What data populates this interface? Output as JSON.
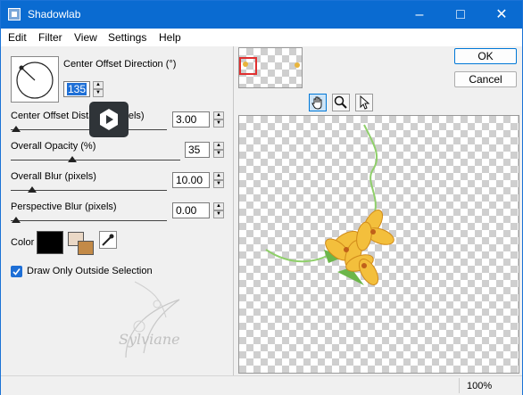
{
  "window": {
    "title": "Shadowlab"
  },
  "menu": [
    "Edit",
    "Filter",
    "View",
    "Settings",
    "Help"
  ],
  "controls": {
    "direction": {
      "label": "Center Offset Direction (°)",
      "value": "135"
    },
    "offset": {
      "label": "Center Offset Distance (pixels)",
      "value": "3.00"
    },
    "opacity": {
      "label": "Overall Opacity (%)",
      "value": "35"
    },
    "blur": {
      "label": "Overall Blur (pixels)",
      "value": "10.00"
    },
    "perspective": {
      "label": "Perspective Blur (pixels)",
      "value": "0.00"
    },
    "color": {
      "label": "Color",
      "swatch": "#000000",
      "secondary_top": "#ead8c6",
      "secondary_bottom": "#c38a47"
    },
    "outside_selection": {
      "label": "Draw Only Outside Selection",
      "checked": true
    }
  },
  "buttons": {
    "ok": "OK",
    "cancel": "Cancel"
  },
  "tools": [
    "hand-icon",
    "zoom-icon",
    "pointer-icon"
  ],
  "watermark": {
    "text": "Sylviane"
  },
  "status": {
    "zoom": "100%"
  },
  "colors": {
    "accent": "#0a6bd1",
    "checkbox": "#1e6fd6"
  }
}
